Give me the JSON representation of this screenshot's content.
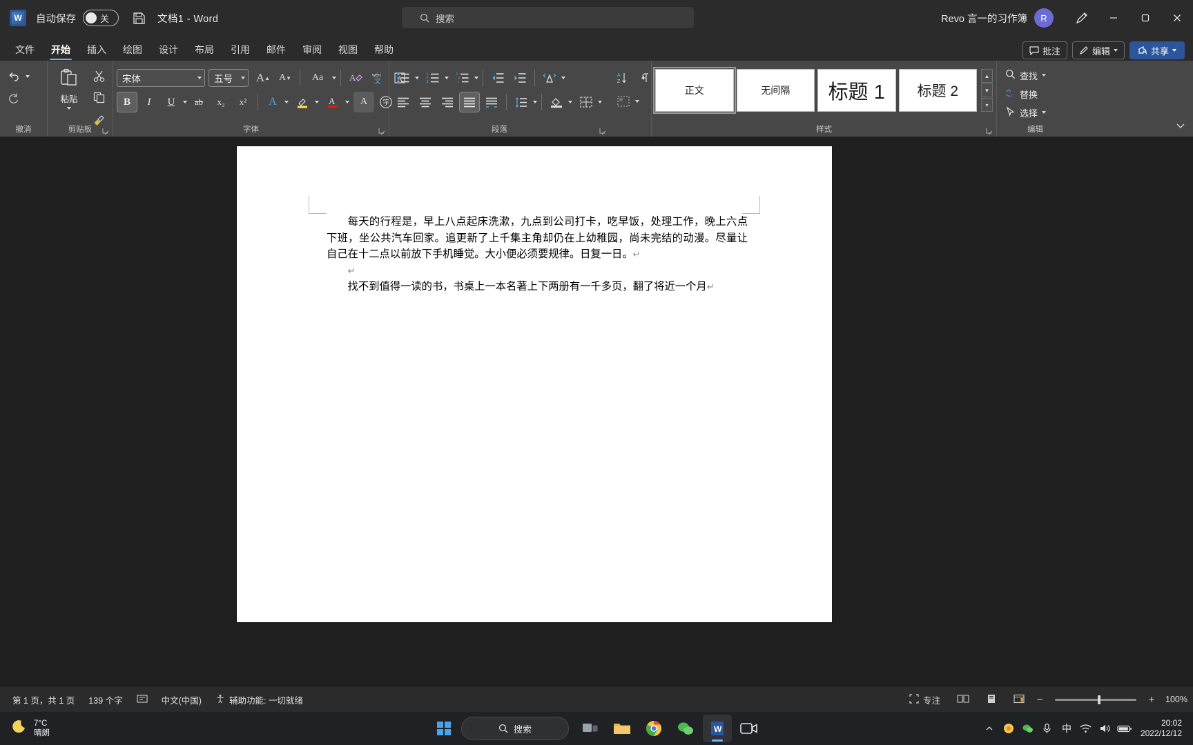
{
  "titlebar": {
    "app_icon": "word-logo",
    "autosave_label": "自动保存",
    "autosave_state": "关",
    "save_icon": "save-icon",
    "document_title": "文档1  -  Word",
    "account_name": "Revo 言一的习作簿",
    "avatar_initial": "R",
    "pen_icon": "pen-tool-icon",
    "minimize": "minimize-icon",
    "maximize": "maximize-icon",
    "close": "close-icon"
  },
  "search": {
    "placeholder": "搜索",
    "icon": "search-icon"
  },
  "tabs": [
    {
      "label": "文件",
      "active": false
    },
    {
      "label": "开始",
      "active": true
    },
    {
      "label": "插入",
      "active": false
    },
    {
      "label": "绘图",
      "active": false
    },
    {
      "label": "设计",
      "active": false
    },
    {
      "label": "布局",
      "active": false
    },
    {
      "label": "引用",
      "active": false
    },
    {
      "label": "邮件",
      "active": false
    },
    {
      "label": "审阅",
      "active": false
    },
    {
      "label": "视图",
      "active": false
    },
    {
      "label": "帮助",
      "active": false
    }
  ],
  "tab_actions": {
    "comment": "批注",
    "edit": "编辑",
    "share": "共享"
  },
  "ribbon": {
    "groups": {
      "undo": "撤消",
      "clipboard": "剪贴板",
      "font": "字体",
      "paragraph": "段落",
      "styles": "样式",
      "editing": "编辑"
    },
    "clipboard": {
      "paste_label": "粘贴",
      "cut_icon": "scissors-icon",
      "copy_icon": "copy-icon",
      "format_painter_icon": "format-painter-icon"
    },
    "font": {
      "font_name": "宋体",
      "font_size": "五号",
      "grow_icon": "grow-font-icon",
      "shrink_icon": "shrink-font-icon",
      "change_case_icon": "change-case-icon",
      "clear_format_icon": "clear-formatting-icon",
      "phonetic_icon": "phonetic-guide-icon",
      "char_border_icon": "character-border-icon",
      "bold": "B",
      "italic": "I",
      "underline": "U",
      "strikethrough": "ab",
      "subscript": "x₂",
      "superscript": "x²",
      "text_effects_icon": "text-effects-icon",
      "highlight_icon": "highlight-color-icon",
      "font_color_icon": "font-color-icon",
      "char_shading_icon": "character-shading-icon",
      "enclose_icon": "enclose-character-icon"
    },
    "paragraph": {
      "bullets_icon": "bullet-list-icon",
      "numbering_icon": "numbered-list-icon",
      "multilevel_icon": "multilevel-list-icon",
      "decrease_indent_icon": "decrease-indent-icon",
      "increase_indent_icon": "increase-indent-icon",
      "cn_layout_icon": "asian-layout-icon",
      "sort_icon": "sort-icon",
      "show_marks_icon": "show-formatting-marks-icon",
      "align_left_icon": "align-left-icon",
      "align_center_icon": "align-center-icon",
      "align_right_icon": "align-right-icon",
      "justify_icon": "justify-icon",
      "distribute_icon": "distribute-icon",
      "line_spacing_icon": "line-spacing-icon",
      "shading_icon": "shading-icon",
      "borders_icon": "borders-icon"
    },
    "styles": [
      {
        "label": "正文",
        "variant": "body",
        "selected": true
      },
      {
        "label": "无间隔",
        "variant": "body",
        "selected": false
      },
      {
        "label": "标题 1",
        "variant": "h1",
        "selected": false
      },
      {
        "label": "标题 2",
        "variant": "h2",
        "selected": false
      }
    ],
    "editing": [
      {
        "label": "查找",
        "icon": "search-icon",
        "caret": true
      },
      {
        "label": "替换",
        "icon": "replace-icon",
        "caret": false
      },
      {
        "label": "选择",
        "icon": "select-cursor-icon",
        "caret": true
      }
    ],
    "collapse_icon": "chevron-down-icon"
  },
  "document": {
    "paragraph1": "每天的行程是，早上八点起床洗漱，九点到公司打卡，吃早饭，处理工作，晚上六点下班，坐公共汽车回家。追更新了上千集主角却仍在上幼稚园，尚未完结的动漫。尽量让自己在十二点以前放下手机睡觉。大小便必须要规律。日复一日。",
    "paragraph_mark": "↵",
    "paragraph2": "找不到值得一读的书，书桌上一本名著上下两册有一千多页，翻了将近一个月"
  },
  "statusbar": {
    "page_info": "第 1 页，共 1 页",
    "word_count": "139 个字",
    "proofing_icon": "proofing-icon",
    "language": "中文(中国)",
    "accessibility_icon": "accessibility-icon",
    "accessibility": "辅助功能: 一切就绪",
    "focus_icon": "focus-mode-icon",
    "focus_label": "专注",
    "read_view_icon": "read-mode-icon",
    "print_view_icon": "print-layout-icon",
    "web_view_icon": "web-layout-icon",
    "zoom_out": "−",
    "zoom_in": "+",
    "zoom_level": "100%"
  },
  "taskbar": {
    "weather_temp": "7°C",
    "weather_desc": "晴朗",
    "weather_icon": "moon-icon",
    "start_icon": "windows-start-icon",
    "search_label": "搜索",
    "search_icon": "search-icon",
    "apps": [
      {
        "name": "task-view-icon"
      },
      {
        "name": "file-explorer-icon"
      },
      {
        "name": "chrome-icon"
      },
      {
        "name": "wechat-icon"
      },
      {
        "name": "word-icon"
      },
      {
        "name": "camera-app-icon"
      }
    ],
    "tray": {
      "chevron": "show-hidden-icons-icon",
      "ime_label": "中",
      "wifi_icon": "wifi-icon",
      "volume_icon": "volume-icon",
      "battery_icon": "battery-icon",
      "mic_icon": "microphone-icon"
    },
    "time": "20:02",
    "date": "2022/12/12"
  },
  "colors": {
    "titlebar_bg": "#2b2b2b",
    "ribbon_bg": "#474747",
    "accent": "#2b579a",
    "tab_underline": "#6cb6ff",
    "page_bg": "#ffffff",
    "desktop_bg": "#1f1f1f"
  }
}
